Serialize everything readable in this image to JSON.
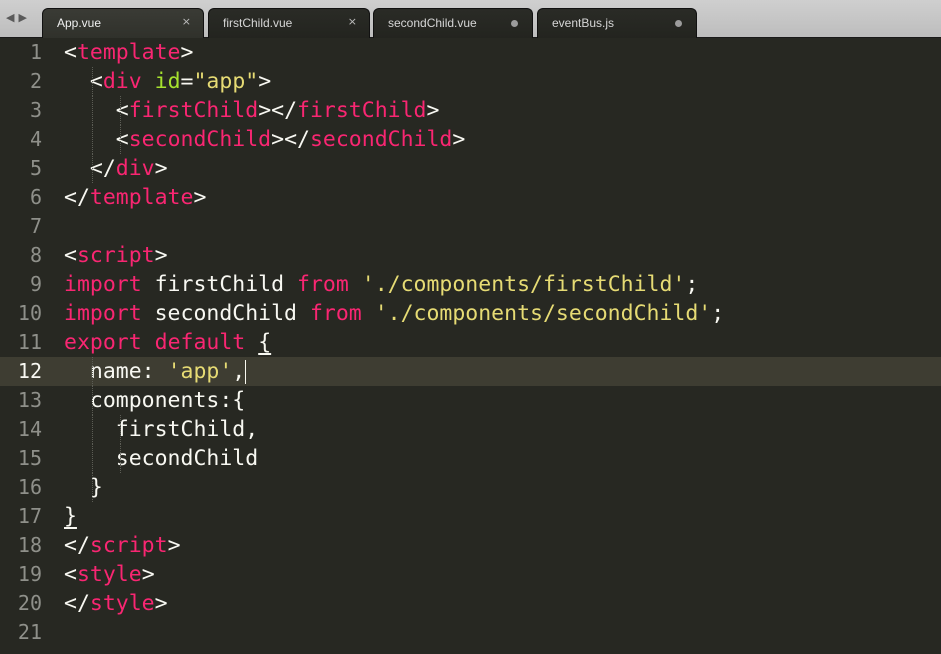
{
  "tabs": [
    {
      "label": "App.vue",
      "state": "close",
      "active": true
    },
    {
      "label": "firstChild.vue",
      "state": "close",
      "active": false
    },
    {
      "label": "secondChild.vue",
      "state": "modified",
      "active": false
    },
    {
      "label": "eventBus.js",
      "state": "modified",
      "active": false
    }
  ],
  "nav": {
    "back": "◀",
    "forward": "▶"
  },
  "close_glyph": "×",
  "editor": {
    "current_line": 12,
    "line_numbers": [
      "1",
      "2",
      "3",
      "4",
      "5",
      "6",
      "7",
      "8",
      "9",
      "10",
      "11",
      "12",
      "13",
      "14",
      "15",
      "16",
      "17",
      "18",
      "19",
      "20",
      "21"
    ],
    "lines": [
      [
        {
          "c": "p",
          "v": "<"
        },
        {
          "c": "t",
          "v": "template"
        },
        {
          "c": "p",
          "v": ">"
        }
      ],
      [
        {
          "c": "p",
          "v": "  <"
        },
        {
          "c": "t",
          "v": "div"
        },
        {
          "c": "p",
          "v": " "
        },
        {
          "c": "a",
          "v": "id"
        },
        {
          "c": "p",
          "v": "="
        },
        {
          "c": "s",
          "v": "\"app\""
        },
        {
          "c": "p",
          "v": ">"
        }
      ],
      [
        {
          "c": "p",
          "v": "    <"
        },
        {
          "c": "t",
          "v": "firstChild"
        },
        {
          "c": "p",
          "v": "></"
        },
        {
          "c": "t",
          "v": "firstChild"
        },
        {
          "c": "p",
          "v": ">"
        }
      ],
      [
        {
          "c": "p",
          "v": "    <"
        },
        {
          "c": "t",
          "v": "secondChild"
        },
        {
          "c": "p",
          "v": "></"
        },
        {
          "c": "t",
          "v": "secondChild"
        },
        {
          "c": "p",
          "v": ">"
        }
      ],
      [
        {
          "c": "p",
          "v": "  </"
        },
        {
          "c": "t",
          "v": "div"
        },
        {
          "c": "p",
          "v": ">"
        }
      ],
      [
        {
          "c": "p",
          "v": "</"
        },
        {
          "c": "t",
          "v": "template"
        },
        {
          "c": "p",
          "v": ">"
        }
      ],
      [],
      [
        {
          "c": "p",
          "v": "<"
        },
        {
          "c": "t",
          "v": "script"
        },
        {
          "c": "p",
          "v": ">"
        }
      ],
      [
        {
          "c": "t",
          "v": "import"
        },
        {
          "c": "p",
          "v": " firstChild "
        },
        {
          "c": "t",
          "v": "from"
        },
        {
          "c": "p",
          "v": " "
        },
        {
          "c": "s",
          "v": "'./components/firstChild'"
        },
        {
          "c": "p",
          "v": ";"
        }
      ],
      [
        {
          "c": "t",
          "v": "import"
        },
        {
          "c": "p",
          "v": " secondChild "
        },
        {
          "c": "t",
          "v": "from"
        },
        {
          "c": "p",
          "v": " "
        },
        {
          "c": "s",
          "v": "'./components/secondChild'"
        },
        {
          "c": "p",
          "v": ";"
        }
      ],
      [
        {
          "c": "t",
          "v": "export"
        },
        {
          "c": "p",
          "v": " "
        },
        {
          "c": "t",
          "v": "default"
        },
        {
          "c": "p",
          "v": " "
        },
        {
          "c": "p u",
          "v": "{"
        }
      ],
      [
        {
          "c": "p",
          "v": "  name: "
        },
        {
          "c": "s",
          "v": "'app'"
        },
        {
          "c": "p",
          "v": ","
        }
      ],
      [
        {
          "c": "p",
          "v": "  components:{"
        }
      ],
      [
        {
          "c": "p",
          "v": "    firstChild,"
        }
      ],
      [
        {
          "c": "p",
          "v": "    secondChild"
        }
      ],
      [
        {
          "c": "p",
          "v": "  }"
        }
      ],
      [
        {
          "c": "p u",
          "v": "}"
        }
      ],
      [
        {
          "c": "p",
          "v": "</"
        },
        {
          "c": "t",
          "v": "script"
        },
        {
          "c": "p",
          "v": ">"
        }
      ],
      [
        {
          "c": "p",
          "v": "<"
        },
        {
          "c": "t",
          "v": "style"
        },
        {
          "c": "p",
          "v": ">"
        }
      ],
      [
        {
          "c": "p",
          "v": "</"
        },
        {
          "c": "t",
          "v": "style"
        },
        {
          "c": "p",
          "v": ">"
        }
      ],
      []
    ]
  },
  "colors": {
    "background": "#272822",
    "tag": "#f92672",
    "attribute": "#a6e22e",
    "string": "#e6db74",
    "plain": "#f8f8f2",
    "gutter": "#8f908a",
    "current_line": "#3e3d32"
  }
}
